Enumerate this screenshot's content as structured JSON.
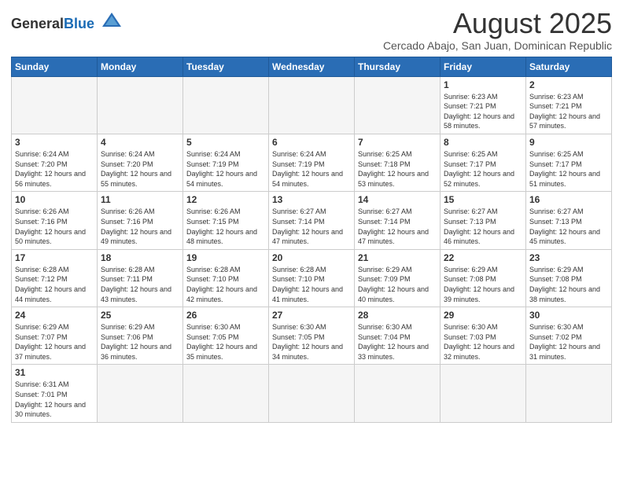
{
  "header": {
    "logo_general": "General",
    "logo_blue": "Blue",
    "main_title": "August 2025",
    "subtitle": "Cercado Abajo, San Juan, Dominican Republic"
  },
  "weekdays": [
    "Sunday",
    "Monday",
    "Tuesday",
    "Wednesday",
    "Thursday",
    "Friday",
    "Saturday"
  ],
  "weeks": [
    [
      {
        "day": "",
        "info": ""
      },
      {
        "day": "",
        "info": ""
      },
      {
        "day": "",
        "info": ""
      },
      {
        "day": "",
        "info": ""
      },
      {
        "day": "",
        "info": ""
      },
      {
        "day": "1",
        "info": "Sunrise: 6:23 AM\nSunset: 7:21 PM\nDaylight: 12 hours\nand 58 minutes."
      },
      {
        "day": "2",
        "info": "Sunrise: 6:23 AM\nSunset: 7:21 PM\nDaylight: 12 hours\nand 57 minutes."
      }
    ],
    [
      {
        "day": "3",
        "info": "Sunrise: 6:24 AM\nSunset: 7:20 PM\nDaylight: 12 hours\nand 56 minutes."
      },
      {
        "day": "4",
        "info": "Sunrise: 6:24 AM\nSunset: 7:20 PM\nDaylight: 12 hours\nand 55 minutes."
      },
      {
        "day": "5",
        "info": "Sunrise: 6:24 AM\nSunset: 7:19 PM\nDaylight: 12 hours\nand 54 minutes."
      },
      {
        "day": "6",
        "info": "Sunrise: 6:24 AM\nSunset: 7:19 PM\nDaylight: 12 hours\nand 54 minutes."
      },
      {
        "day": "7",
        "info": "Sunrise: 6:25 AM\nSunset: 7:18 PM\nDaylight: 12 hours\nand 53 minutes."
      },
      {
        "day": "8",
        "info": "Sunrise: 6:25 AM\nSunset: 7:17 PM\nDaylight: 12 hours\nand 52 minutes."
      },
      {
        "day": "9",
        "info": "Sunrise: 6:25 AM\nSunset: 7:17 PM\nDaylight: 12 hours\nand 51 minutes."
      }
    ],
    [
      {
        "day": "10",
        "info": "Sunrise: 6:26 AM\nSunset: 7:16 PM\nDaylight: 12 hours\nand 50 minutes."
      },
      {
        "day": "11",
        "info": "Sunrise: 6:26 AM\nSunset: 7:16 PM\nDaylight: 12 hours\nand 49 minutes."
      },
      {
        "day": "12",
        "info": "Sunrise: 6:26 AM\nSunset: 7:15 PM\nDaylight: 12 hours\nand 48 minutes."
      },
      {
        "day": "13",
        "info": "Sunrise: 6:27 AM\nSunset: 7:14 PM\nDaylight: 12 hours\nand 47 minutes."
      },
      {
        "day": "14",
        "info": "Sunrise: 6:27 AM\nSunset: 7:14 PM\nDaylight: 12 hours\nand 47 minutes."
      },
      {
        "day": "15",
        "info": "Sunrise: 6:27 AM\nSunset: 7:13 PM\nDaylight: 12 hours\nand 46 minutes."
      },
      {
        "day": "16",
        "info": "Sunrise: 6:27 AM\nSunset: 7:13 PM\nDaylight: 12 hours\nand 45 minutes."
      }
    ],
    [
      {
        "day": "17",
        "info": "Sunrise: 6:28 AM\nSunset: 7:12 PM\nDaylight: 12 hours\nand 44 minutes."
      },
      {
        "day": "18",
        "info": "Sunrise: 6:28 AM\nSunset: 7:11 PM\nDaylight: 12 hours\nand 43 minutes."
      },
      {
        "day": "19",
        "info": "Sunrise: 6:28 AM\nSunset: 7:10 PM\nDaylight: 12 hours\nand 42 minutes."
      },
      {
        "day": "20",
        "info": "Sunrise: 6:28 AM\nSunset: 7:10 PM\nDaylight: 12 hours\nand 41 minutes."
      },
      {
        "day": "21",
        "info": "Sunrise: 6:29 AM\nSunset: 7:09 PM\nDaylight: 12 hours\nand 40 minutes."
      },
      {
        "day": "22",
        "info": "Sunrise: 6:29 AM\nSunset: 7:08 PM\nDaylight: 12 hours\nand 39 minutes."
      },
      {
        "day": "23",
        "info": "Sunrise: 6:29 AM\nSunset: 7:08 PM\nDaylight: 12 hours\nand 38 minutes."
      }
    ],
    [
      {
        "day": "24",
        "info": "Sunrise: 6:29 AM\nSunset: 7:07 PM\nDaylight: 12 hours\nand 37 minutes."
      },
      {
        "day": "25",
        "info": "Sunrise: 6:29 AM\nSunset: 7:06 PM\nDaylight: 12 hours\nand 36 minutes."
      },
      {
        "day": "26",
        "info": "Sunrise: 6:30 AM\nSunset: 7:05 PM\nDaylight: 12 hours\nand 35 minutes."
      },
      {
        "day": "27",
        "info": "Sunrise: 6:30 AM\nSunset: 7:05 PM\nDaylight: 12 hours\nand 34 minutes."
      },
      {
        "day": "28",
        "info": "Sunrise: 6:30 AM\nSunset: 7:04 PM\nDaylight: 12 hours\nand 33 minutes."
      },
      {
        "day": "29",
        "info": "Sunrise: 6:30 AM\nSunset: 7:03 PM\nDaylight: 12 hours\nand 32 minutes."
      },
      {
        "day": "30",
        "info": "Sunrise: 6:30 AM\nSunset: 7:02 PM\nDaylight: 12 hours\nand 31 minutes."
      }
    ],
    [
      {
        "day": "31",
        "info": "Sunrise: 6:31 AM\nSunset: 7:01 PM\nDaylight: 12 hours\nand 30 minutes."
      },
      {
        "day": "",
        "info": ""
      },
      {
        "day": "",
        "info": ""
      },
      {
        "day": "",
        "info": ""
      },
      {
        "day": "",
        "info": ""
      },
      {
        "day": "",
        "info": ""
      },
      {
        "day": "",
        "info": ""
      }
    ]
  ]
}
